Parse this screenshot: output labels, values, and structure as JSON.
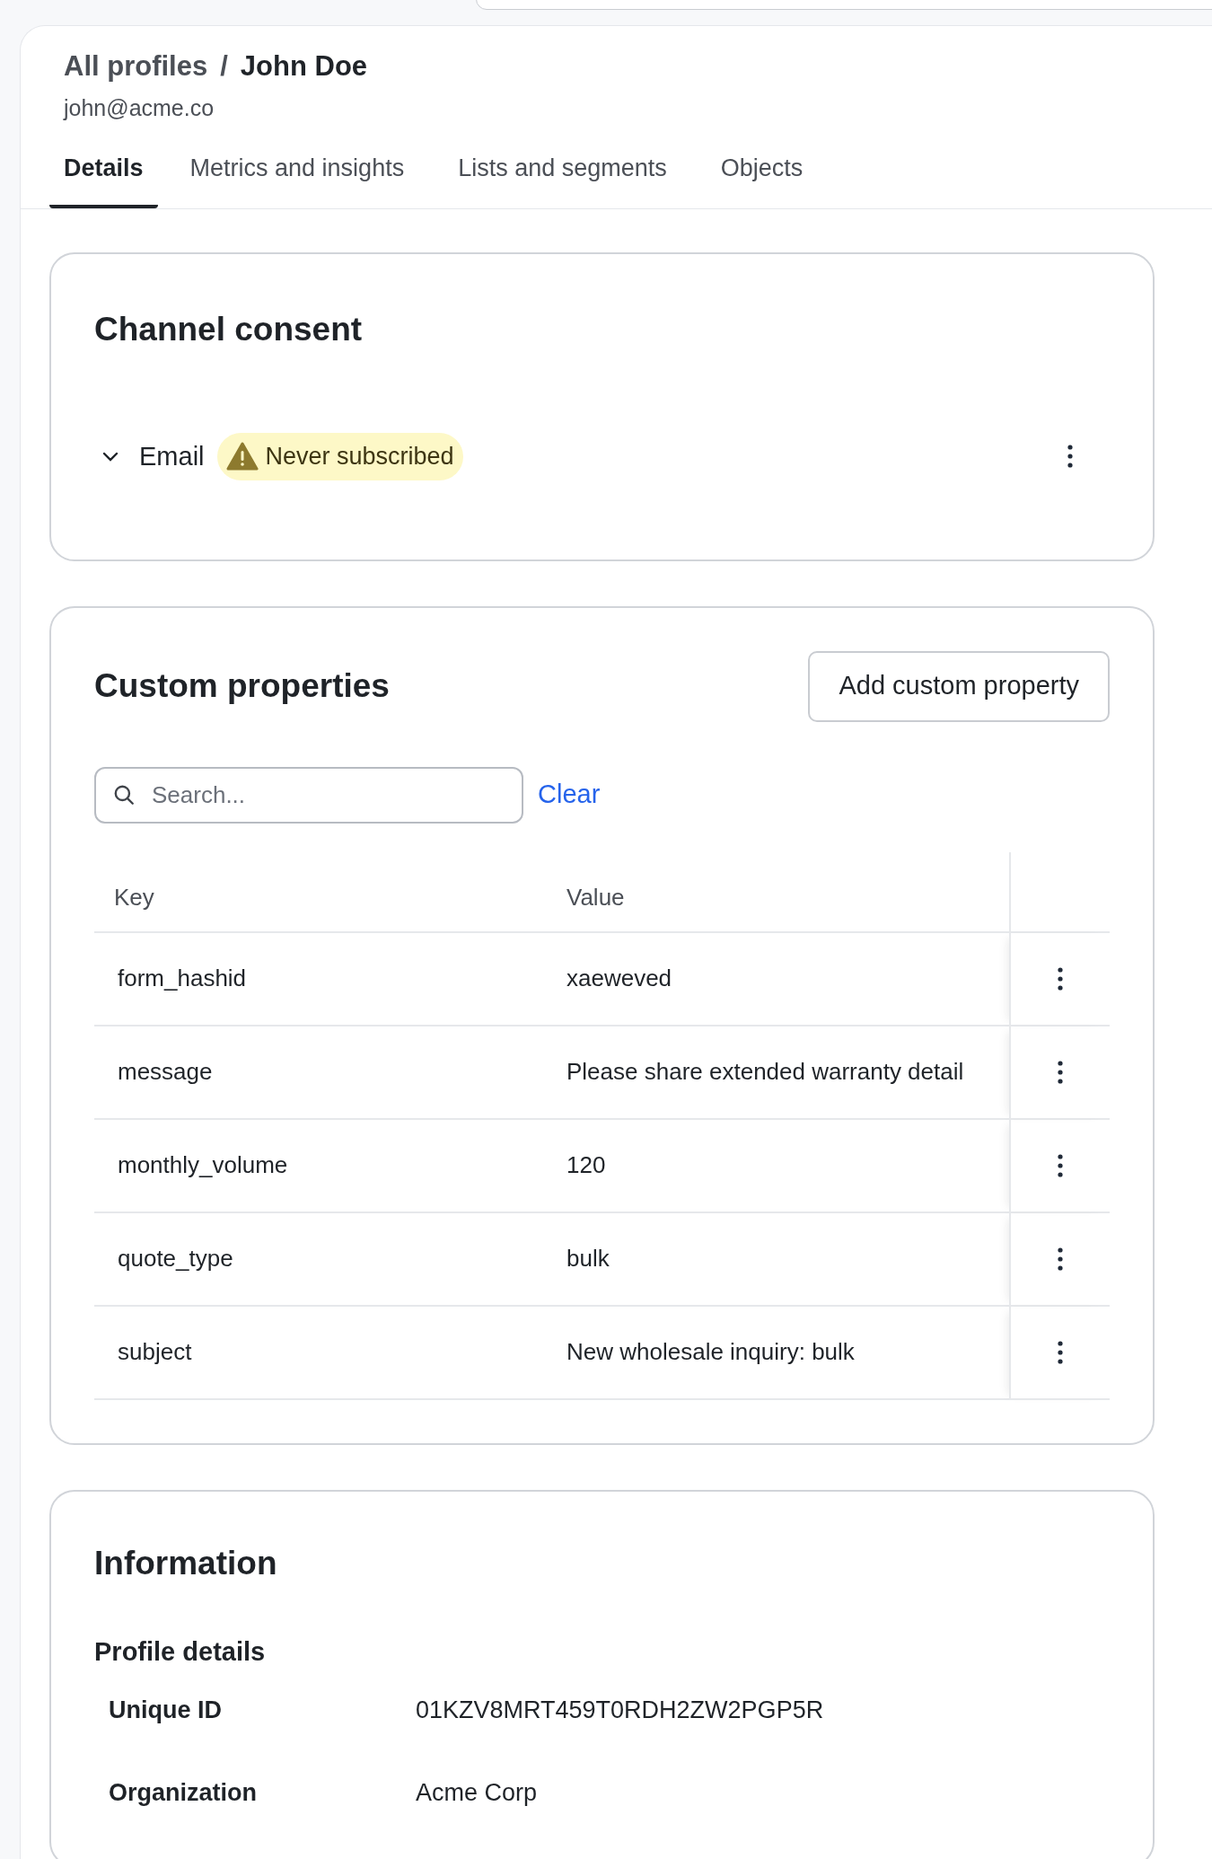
{
  "breadcrumb": {
    "parent": "All profiles",
    "separator": "/",
    "current": "John Doe"
  },
  "email": "john@acme.co",
  "tabs": [
    {
      "label": "Details",
      "selected": true
    },
    {
      "label": "Metrics and insights",
      "selected": false
    },
    {
      "label": "Lists and segments",
      "selected": false
    },
    {
      "label": "Objects",
      "selected": false
    }
  ],
  "channel_consent": {
    "title": "Channel consent",
    "channels": [
      {
        "name": "Email",
        "expanded": false,
        "status": "Never subscribed"
      }
    ]
  },
  "custom_properties": {
    "title": "Custom properties",
    "add_button": "Add custom property",
    "search": {
      "placeholder": "Search..."
    },
    "clear": "Clear",
    "columns": [
      "Key",
      "Value"
    ],
    "rows": [
      {
        "key": "form_hashid",
        "value": "xaeweved"
      },
      {
        "key": "message",
        "value": "Please share extended warranty detail"
      },
      {
        "key": "monthly_volume",
        "value": "120"
      },
      {
        "key": "quote_type",
        "value": "bulk"
      },
      {
        "key": "subject",
        "value": "New wholesale inquiry: bulk"
      }
    ]
  },
  "information": {
    "title": "Information",
    "section": "Profile details",
    "fields": [
      {
        "label": "Unique ID",
        "value": "01KZV8MRT459T0RDH2ZW2PGP5R"
      },
      {
        "label": "Organization",
        "value": "Acme Corp"
      }
    ]
  }
}
